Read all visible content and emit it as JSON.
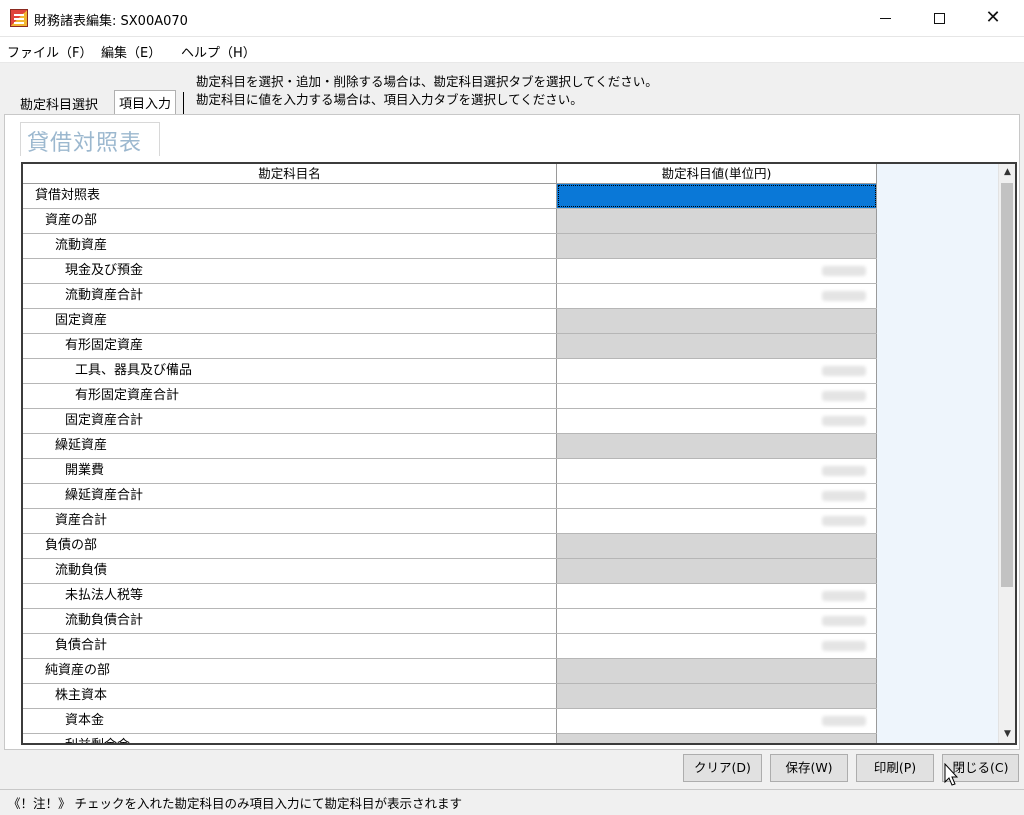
{
  "window": {
    "title": "財務諸表編集: SX00A070"
  },
  "menu": {
    "items": [
      {
        "label": "ファイル（F）"
      },
      {
        "label": "編集（E）"
      },
      {
        "label": "ヘルプ（H）"
      }
    ]
  },
  "tabs": {
    "select_label": "勘定科目選択",
    "input_label": "項目入力"
  },
  "notes": {
    "line1": "勘定科目を選択・追加・削除する場合は、勘定科目選択タブを選択してください。",
    "line2": "勘定科目に値を入力する場合は、項目入力タブを選択してください。"
  },
  "sheet": {
    "title": "貸借対照表"
  },
  "table": {
    "columns": [
      "勘定科目名",
      "勘定科目値(単位円)"
    ],
    "rows": [
      {
        "name": "貸借対照表",
        "level": 0,
        "type": "selected"
      },
      {
        "name": "資産の部",
        "level": 1,
        "type": "heading"
      },
      {
        "name": "流動資産",
        "level": 2,
        "type": "heading"
      },
      {
        "name": "現金及び預金",
        "level": 3,
        "type": "value"
      },
      {
        "name": "流動資産合計",
        "level": 3,
        "type": "value"
      },
      {
        "name": "固定資産",
        "level": 2,
        "type": "heading"
      },
      {
        "name": "有形固定資産",
        "level": 3,
        "type": "heading"
      },
      {
        "name": "工具、器具及び備品",
        "level": 4,
        "type": "value"
      },
      {
        "name": "有形固定資産合計",
        "level": 4,
        "type": "value"
      },
      {
        "name": "固定資産合計",
        "level": 3,
        "type": "value"
      },
      {
        "name": "繰延資産",
        "level": 2,
        "type": "heading"
      },
      {
        "name": "開業費",
        "level": 3,
        "type": "value"
      },
      {
        "name": "繰延資産合計",
        "level": 3,
        "type": "value"
      },
      {
        "name": "資産合計",
        "level": 2,
        "type": "value"
      },
      {
        "name": "負債の部",
        "level": 1,
        "type": "heading"
      },
      {
        "name": "流動負債",
        "level": 2,
        "type": "heading"
      },
      {
        "name": "未払法人税等",
        "level": 3,
        "type": "value"
      },
      {
        "name": "流動負債合計",
        "level": 3,
        "type": "value"
      },
      {
        "name": "負債合計",
        "level": 2,
        "type": "value"
      },
      {
        "name": "純資産の部",
        "level": 1,
        "type": "heading"
      },
      {
        "name": "株主資本",
        "level": 2,
        "type": "heading"
      },
      {
        "name": "資本金",
        "level": 3,
        "type": "value"
      },
      {
        "name": "利益剰余金",
        "level": 3,
        "type": "heading"
      }
    ]
  },
  "buttons": {
    "clear": "クリア(D)",
    "save": "保存(W)",
    "print": "印刷(P)",
    "close": "閉じる(C)"
  },
  "status": {
    "text": "《！注！》 チェックを入れた勘定科目のみ項目入力にて勘定科目が表示されます"
  },
  "colors": {
    "selected": "#0a78d7",
    "heading_cell": "#d6d6d6",
    "sheet_title": "#9cb8cf"
  }
}
